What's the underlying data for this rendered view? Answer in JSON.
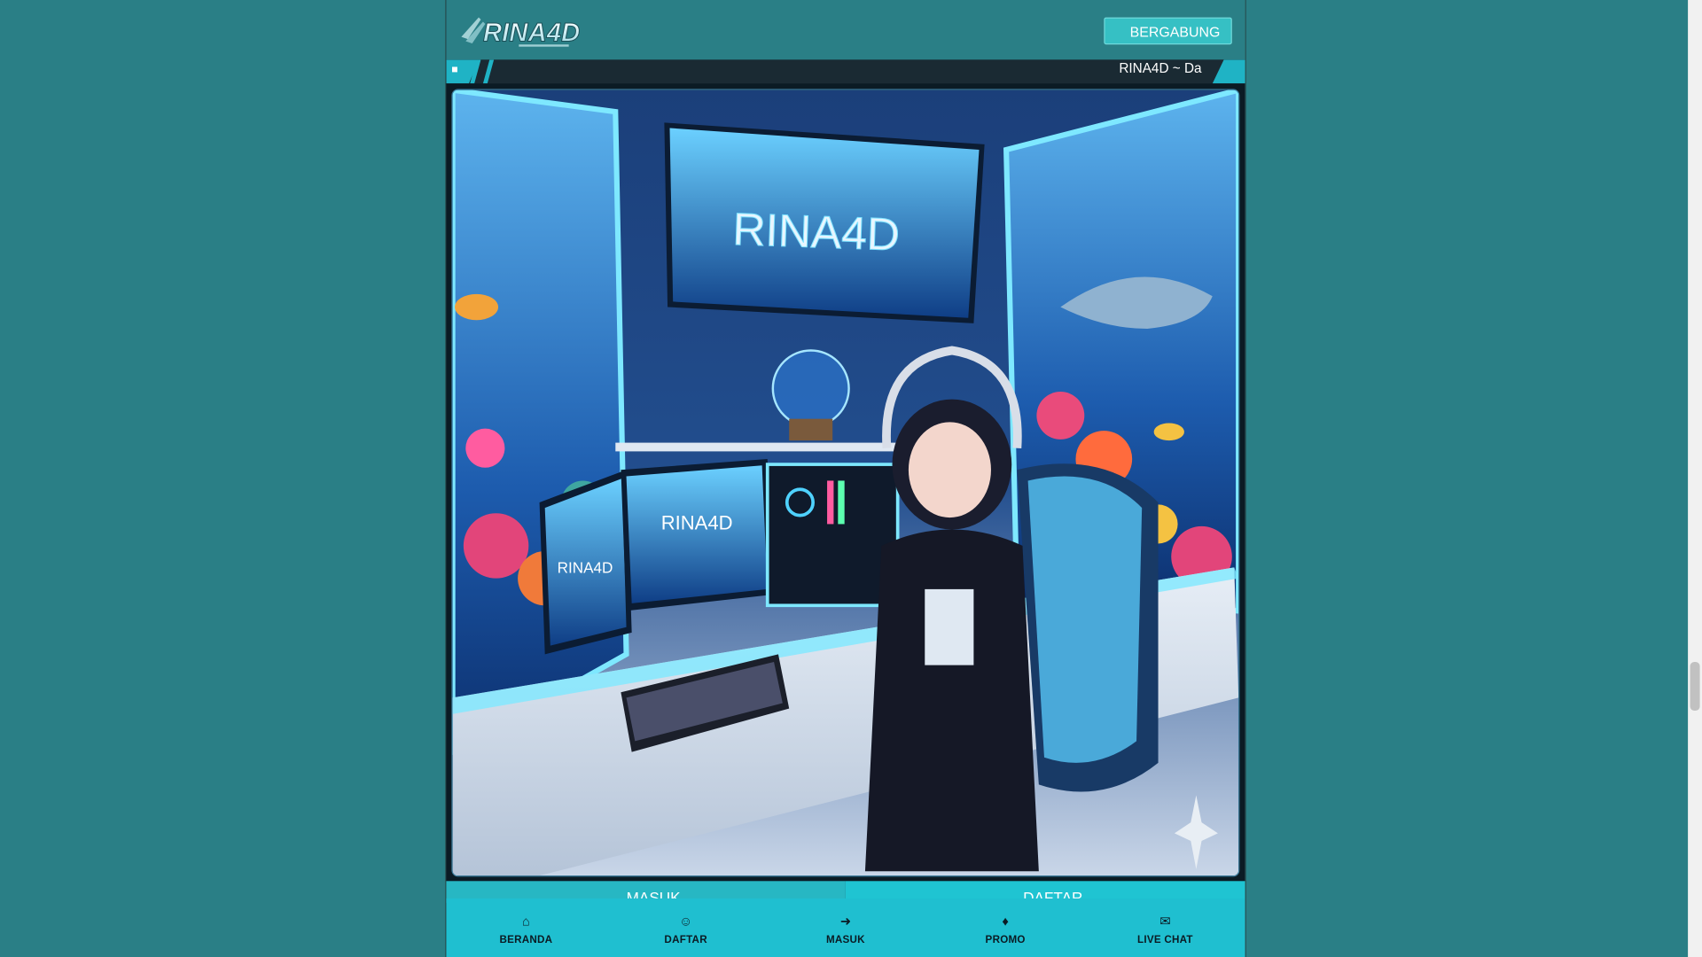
{
  "header": {
    "logo_text": "RINA4D",
    "join_button": " BERGABUNG"
  },
  "ticker": {
    "text": "RINA4D ~ Da"
  },
  "banner": {
    "screen_text": "RINA4D",
    "monitor_text_1": "RINA4D",
    "monitor_text_2": "RINA4D"
  },
  "actions": {
    "masuk": " MASUK",
    "daftar": " DAFTAR"
  },
  "bottom_nav": [
    {
      "label": "BERANDA",
      "icon": "home-icon"
    },
    {
      "label": "DAFTAR",
      "icon": "user-plus-icon"
    },
    {
      "label": "MASUK",
      "icon": "login-icon"
    },
    {
      "label": "PROMO",
      "icon": "gift-icon"
    },
    {
      "label": "LIVE CHAT",
      "icon": "chat-icon"
    }
  ],
  "colors": {
    "background": "#2a7f86",
    "accent": "#1fbfd0",
    "dark": "#0b1b24"
  }
}
